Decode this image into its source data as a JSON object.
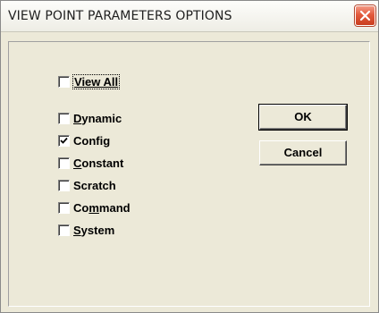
{
  "window": {
    "title": "VIEW POINT PARAMETERS OPTIONS",
    "close_icon": "close-icon"
  },
  "options": {
    "view_all": {
      "label": "View All",
      "checked": false
    },
    "items": [
      {
        "label": "Dynamic",
        "checked": false
      },
      {
        "label": "Config",
        "checked": true
      },
      {
        "label": "Constant",
        "checked": false
      },
      {
        "label": "Scratch",
        "checked": false
      },
      {
        "label": "Command",
        "checked": false
      },
      {
        "label": "System",
        "checked": false
      }
    ]
  },
  "buttons": {
    "ok_label": "OK",
    "cancel_label": "Cancel"
  },
  "colors": {
    "dialog_bg": "#ece9d8",
    "close_button": "#e35a3d"
  }
}
